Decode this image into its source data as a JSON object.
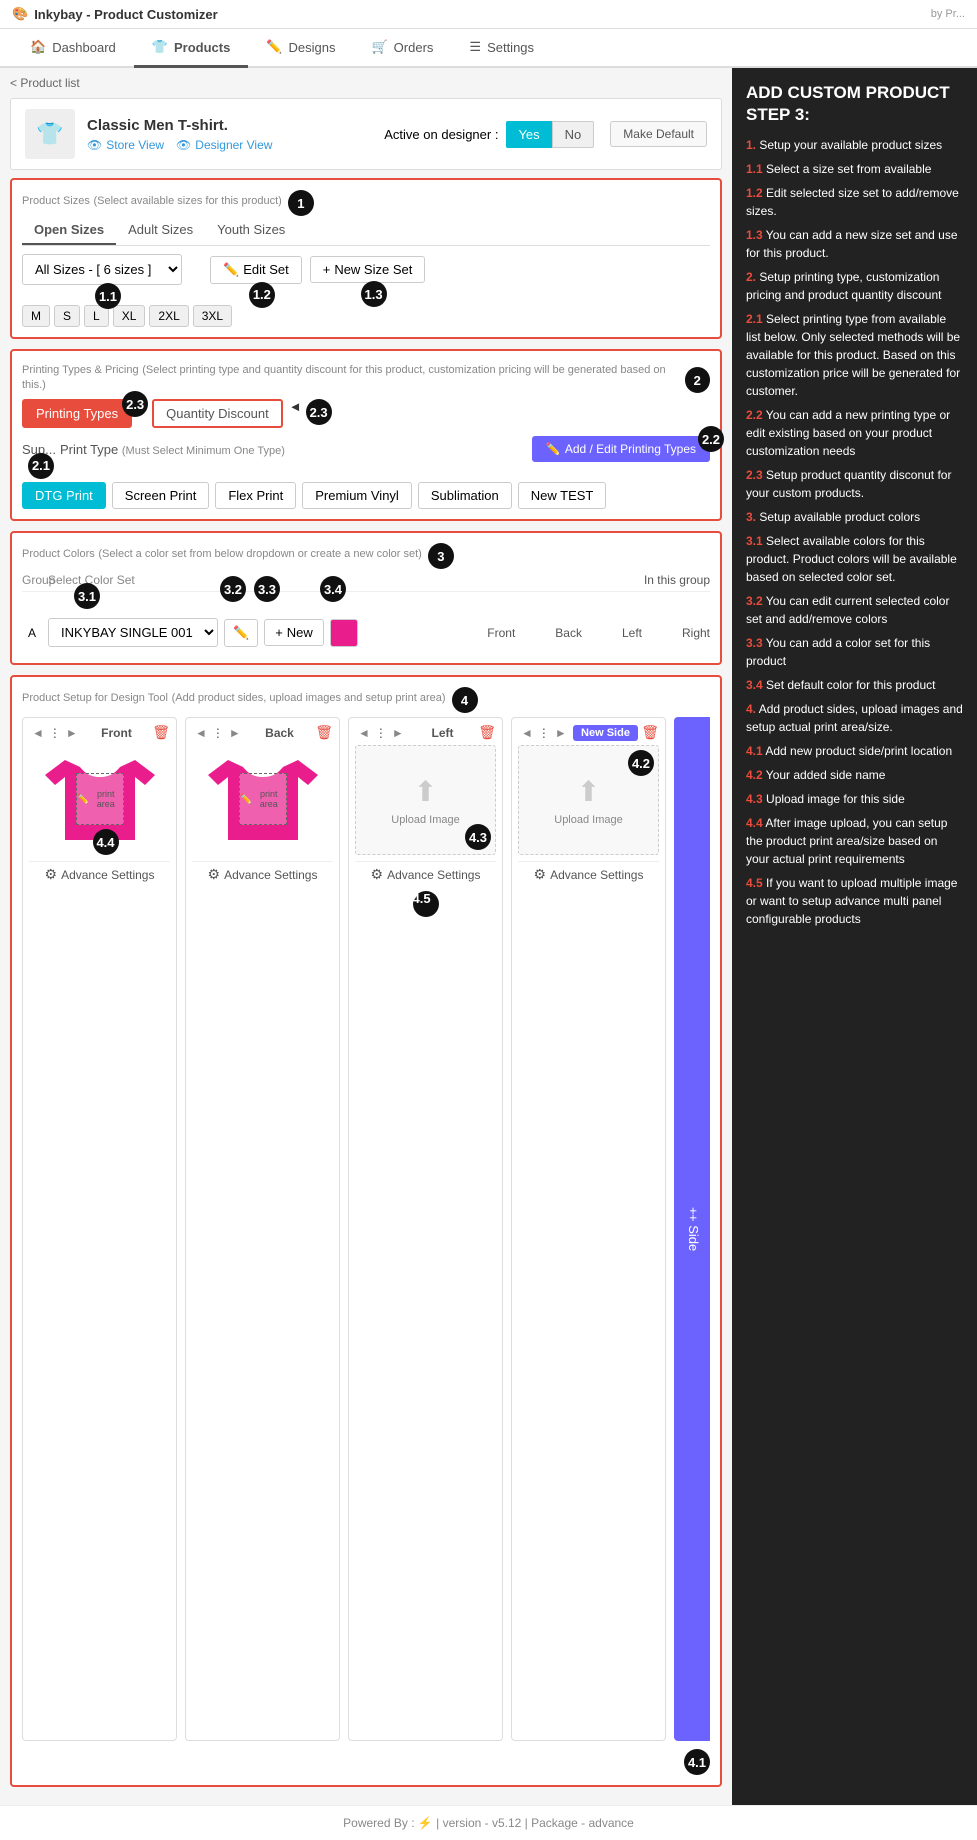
{
  "app": {
    "title": "Inkybay - Product Customizer",
    "by": "by Pr..."
  },
  "nav": {
    "tabs": [
      {
        "label": "Dashboard",
        "icon": "🏠",
        "active": false
      },
      {
        "label": "Products",
        "icon": "👕",
        "active": true
      },
      {
        "label": "Designs",
        "icon": "✏️",
        "active": false
      },
      {
        "label": "Orders",
        "icon": "🛒",
        "active": false
      },
      {
        "label": "Settings",
        "icon": "☰",
        "active": false
      }
    ]
  },
  "breadcrumb": "< Product list",
  "product": {
    "name": "Classic Men T-shirt.",
    "store_view": "Store View",
    "designer_view": "Designer View",
    "active_label": "Active on designer :",
    "yes_label": "Yes",
    "no_label": "No",
    "make_default": "Make Default"
  },
  "sections": {
    "sizes": {
      "title": "Product Sizes",
      "subtitle": "(Select available sizes for this product)",
      "step": "1",
      "tabs": [
        "Open Sizes",
        "Adult Sizes",
        "Youth Sizes"
      ],
      "active_tab": "Open Sizes",
      "select_value": "All Sizes - [ 6 sizes ]",
      "edit_set": "Edit Set",
      "new_size_set": "New Size Set",
      "chips": [
        "M",
        "S",
        "L",
        "XL",
        "2XL",
        "3XL"
      ],
      "step_labels": {
        "1.1": "1.1",
        "1.2": "1.2",
        "1.3": "1.3"
      }
    },
    "printing": {
      "title": "Printing Types & Pricing",
      "subtitle": "(Select printing type and quantity discount for this product, customization pricing will be generated based on this.)",
      "step": "2",
      "type_tabs": [
        "Printing Types",
        "Quantity Discount"
      ],
      "active_type_tab": "Printing Types",
      "print_label": "Sup... Print Type (Must Select Minimum One Type)",
      "add_edit_btn": "Add / Edit Printing Types",
      "types": [
        "DTG Print",
        "Screen Print",
        "Flex Print",
        "Premium Vinyl",
        "Sublimation",
        "New TEST"
      ],
      "selected_type": "DTG Print",
      "step_labels": {
        "2.1": "2.1",
        "2.2": "2.2",
        "2.3": "2.3"
      }
    },
    "colors": {
      "title": "Product Colors",
      "subtitle": "(Select a color set from below dropdown or create a new color set)",
      "step": "3",
      "headers": [
        "Group",
        "Select Color Set",
        "",
        "",
        "",
        "In this group"
      ],
      "group": "A",
      "select_value": "INKYBAY SINGLE 001",
      "side_labels": [
        "Front",
        "Back",
        "Left",
        "Right"
      ],
      "step_labels": {
        "3.1": "3.1",
        "3.2": "3.2",
        "3.3": "3.3",
        "3.4": "3.4"
      },
      "new_label": "New"
    },
    "design_tool": {
      "title": "Product Setup for Design Tool",
      "subtitle": "(Add product sides, upload images and setup print area)",
      "step": "4",
      "sides": [
        {
          "name": "Front",
          "type": "tshirt",
          "has_print_area": true,
          "print_area_label": "print area"
        },
        {
          "name": "Back",
          "type": "tshirt",
          "has_print_area": true,
          "print_area_label": "print area"
        },
        {
          "name": "Left",
          "type": "upload"
        },
        {
          "name": "New Side",
          "type": "upload",
          "is_new": true
        }
      ],
      "add_side_btn": "+ Side",
      "upload_text": "Upload Image",
      "advance_settings": "Advance Settings",
      "step_labels": {
        "4.1": "4.1",
        "4.2": "4.2",
        "4.3": "4.3",
        "4.4": "4.4",
        "4.5": "4.5"
      }
    }
  },
  "right_panel": {
    "title": "ADD CUSTOM PRODUCT STEP 3:",
    "items": [
      {
        "num": "1.",
        "text": "Setup your available product sizes"
      },
      {
        "num": "1.1",
        "text": "Select a size set from available"
      },
      {
        "num": "1.2",
        "text": "Edit selected size set to add/remove sizes."
      },
      {
        "num": "1.3",
        "text": "You can add a new size set and use for this product."
      },
      {
        "num": "2.",
        "text": "Setup printing type, customization pricing and product quantity discount"
      },
      {
        "num": "2.1",
        "text": "Select printing type from available list below. Only selected methods will be available for this product. Based on this customization price will be generated for customer."
      },
      {
        "num": "2.2",
        "text": "You can add a new printing type or edit existing based on your product customization needs"
      },
      {
        "num": "2.3",
        "text": "Setup product quantity disconut for your custom products."
      },
      {
        "num": "3.",
        "text": "Setup available product colors"
      },
      {
        "num": "3.1",
        "text": "Select available colors for this product. Product colors will be available based on selected color set."
      },
      {
        "num": "3.2",
        "text": "You can edit current selected color set and add/remove colors"
      },
      {
        "num": "3.3",
        "text": "You can add a color set for this product"
      },
      {
        "num": "3.4",
        "text": "Set default color for this product"
      },
      {
        "num": "4.",
        "text": "Add product sides, upload images and setup actual print area/size."
      },
      {
        "num": "4.1",
        "text": "Add new product side/print location"
      },
      {
        "num": "4.2",
        "text": "Your added side name"
      },
      {
        "num": "4.3",
        "text": "Upload image for this side"
      },
      {
        "num": "4.4",
        "text": "After image upload, you can setup the product print area/size based on your actual print requirements"
      },
      {
        "num": "4.5",
        "text": "If you want to upload multiple image or want to setup advance multi panel configurable products"
      }
    ]
  },
  "footer": {
    "powered_by": "Powered By :",
    "version": "version - v5.12",
    "package": "Package - advance"
  }
}
